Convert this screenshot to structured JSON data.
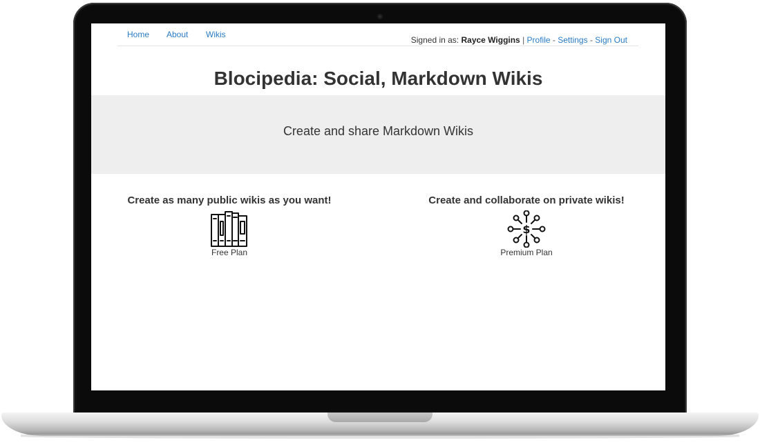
{
  "nav": {
    "home": "Home",
    "about": "About",
    "wikis": "Wikis"
  },
  "account": {
    "signed_in_label": "Signed in as:",
    "user_name": "Rayce Wiggins",
    "divider": "|",
    "profile": "Profile",
    "dash": "-",
    "settings": "Settings",
    "sign_out": "Sign Out"
  },
  "hero": {
    "title": "Blocipedia: Social, Markdown Wikis",
    "tagline": "Create and share Markdown Wikis"
  },
  "plans": [
    {
      "heading": "Create as many public wikis as you want!",
      "label": "Free Plan",
      "icon": "books-icon"
    },
    {
      "heading": "Create and collaborate on private wikis!",
      "label": "Premium Plan",
      "icon": "network-dollar-icon"
    }
  ],
  "colors": {
    "link": "#2a7bc4",
    "jumbotron": "#eeeeee",
    "text": "#333333",
    "laptop_bezel": "#0b0b0b"
  }
}
